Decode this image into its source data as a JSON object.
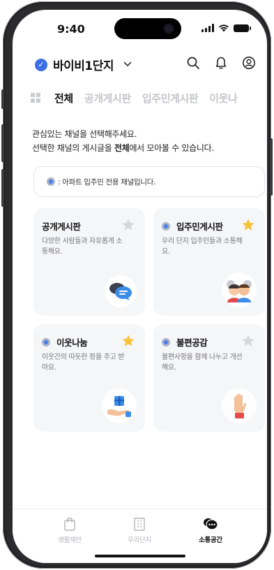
{
  "status_bar": {
    "time": "9:40"
  },
  "header": {
    "complex_name": "바이비1단지",
    "check_icon": "check-badge-icon"
  },
  "tabs": [
    {
      "label": "전체",
      "active": true
    },
    {
      "label": "공개게시판",
      "active": false
    },
    {
      "label": "입주민게시판",
      "active": false
    },
    {
      "label": "이웃나",
      "active": false
    }
  ],
  "intro": {
    "line1": "관심있는 채널을 선택해주세요.",
    "line2_before": "선택한 채널의 게시글을 ",
    "line2_bold": "전체",
    "line2_after": "에서 모아볼 수 있습니다."
  },
  "notice": {
    "text": ": 아파트 입주민 전용 채널입니다."
  },
  "cards": [
    {
      "title": "공개게시판",
      "desc": "다양한 사람들과 자유롭게 소통해요.",
      "resident_only": false,
      "starred": false,
      "illustration": "chat-bubbles-icon"
    },
    {
      "title": "입주민게시판",
      "desc": "우리 단지 입주민들과 소통해요.",
      "resident_only": true,
      "starred": true,
      "illustration": "neighbors-icon"
    },
    {
      "title": "이웃나눔",
      "desc": "이웃간의 따듯한 정을 주고 받아요.",
      "resident_only": true,
      "starred": true,
      "illustration": "gift-hand-icon"
    },
    {
      "title": "불편공감",
      "desc": "불편사항을 함께 나누고 개선해요.",
      "resident_only": true,
      "starred": false,
      "illustration": "raised-hand-icon"
    }
  ],
  "bottom_nav": [
    {
      "label": "생활제안",
      "icon": "shopping-bag-icon",
      "active": false
    },
    {
      "label": "우리단지",
      "icon": "building-icon",
      "active": false
    },
    {
      "label": "소통공간",
      "icon": "chat-icon",
      "active": true
    }
  ],
  "colors": {
    "accent": "#3b6fe3",
    "star_active": "#f6c33a",
    "star_inactive": "#d5d7db",
    "card_bg": "#f5f6f8"
  }
}
